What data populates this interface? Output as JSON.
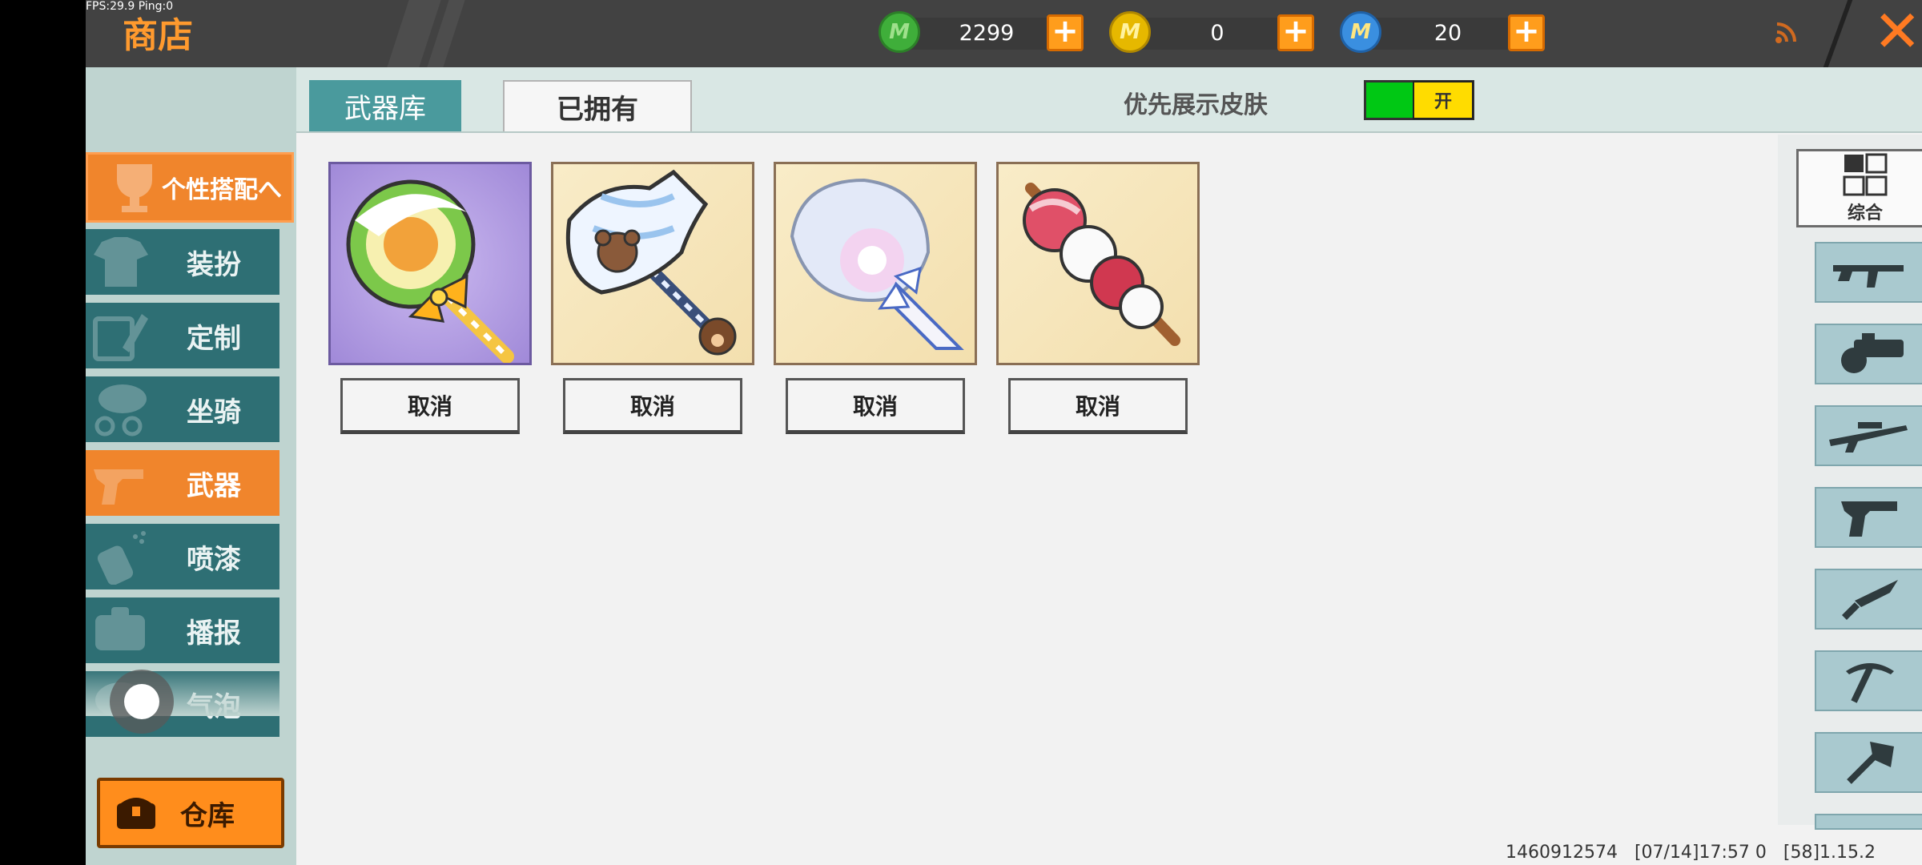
{
  "debug": {
    "fps_text": "FPS:29.9  Ping:0"
  },
  "header": {
    "title": "商店",
    "currencies": [
      {
        "name": "green-gem",
        "value": "2299",
        "color": "#3fae3a",
        "symbol": "M"
      },
      {
        "name": "gold-coin",
        "value": "0",
        "color": "#e6b800",
        "symbol": "M"
      },
      {
        "name": "blue-coin",
        "value": "20",
        "color": "#3a8fe0",
        "symbol": "M"
      }
    ],
    "plus_symbol": "+",
    "close_symbol": "✕"
  },
  "sidebar": {
    "group_label": "个性搭配へ",
    "items": [
      {
        "label": "装扮",
        "icon": "shirt-icon",
        "active": false
      },
      {
        "label": "定制",
        "icon": "pencil-icon",
        "active": false
      },
      {
        "label": "坐骑",
        "icon": "mount-icon",
        "active": false
      },
      {
        "label": "武器",
        "icon": "revolver-icon",
        "active": true
      },
      {
        "label": "喷漆",
        "icon": "spray-can-icon",
        "active": false
      },
      {
        "label": "播报",
        "icon": "broadcast-icon",
        "active": false
      },
      {
        "label": "气泡",
        "icon": "bubble-icon",
        "active": false
      }
    ],
    "warehouse_label": "仓库"
  },
  "tabs": {
    "armory": "武器库",
    "owned": "已拥有",
    "active": "owned"
  },
  "skin_toggle": {
    "label": "优先展示皮肤",
    "state_text": "开",
    "on": true
  },
  "items": [
    {
      "name": "lollipop-weapon",
      "button": "取消"
    },
    {
      "name": "teddy-axe-weapon",
      "button": "取消"
    },
    {
      "name": "cotton-candy-weapon",
      "button": "取消"
    },
    {
      "name": "candied-haws-weapon",
      "button": "取消"
    }
  ],
  "filters": {
    "all_label": "综合",
    "categories": [
      "rifle-icon",
      "gatling-icon",
      "sniper-icon",
      "revolver-icon",
      "knife-icon",
      "pickaxe-icon",
      "axe-icon"
    ]
  },
  "footer": {
    "info": "1460912574   [07/14]17:57 0   [58]1.15.2"
  },
  "colors": {
    "accent_orange": "#f0852c",
    "teal": "#2e6f74",
    "toggle_green": "#00c814",
    "toggle_yellow": "#ffdc00"
  }
}
